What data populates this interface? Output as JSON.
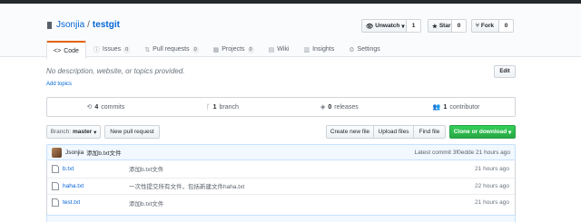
{
  "repo": {
    "owner": "Jsonjia",
    "separator": "/",
    "name": "testgit"
  },
  "actions": {
    "watch": {
      "label": "Unwatch",
      "count": "1"
    },
    "star": {
      "label": "Star",
      "count": "0"
    },
    "fork": {
      "label": "Fork",
      "count": "0"
    }
  },
  "tabs": [
    {
      "label": "Code",
      "counter": ""
    },
    {
      "label": "Issues",
      "counter": "0"
    },
    {
      "label": "Pull requests",
      "counter": "0"
    },
    {
      "label": "Projects",
      "counter": "0"
    },
    {
      "label": "Wiki",
      "counter": ""
    },
    {
      "label": "Insights",
      "counter": ""
    },
    {
      "label": "Settings",
      "counter": ""
    }
  ],
  "description": {
    "text": "No description, website, or topics provided.",
    "add_topics": "Add topics",
    "edit_label": "Edit"
  },
  "summary": {
    "commits_num": "4",
    "commits_label": "commits",
    "branch_num": "1",
    "branch_label": "branch",
    "releases_num": "0",
    "releases_label": "releases",
    "contributors_num": "1",
    "contributors_label": "contributor"
  },
  "toolbar": {
    "branch_label": "Branch:",
    "branch_value": "master",
    "new_pr": "New pull request",
    "create_file": "Create new file",
    "upload_files": "Upload files",
    "find_file": "Find file",
    "clone": "Clone or download"
  },
  "latest_commit": {
    "author": "Jsonjia",
    "message": "添加b.txt文件",
    "prefix": "Latest commit",
    "sha": "3f0edde",
    "age": "21 hours ago"
  },
  "files": [
    {
      "name": "b.txt",
      "message": "添加b.txt文件",
      "age": "21 hours ago"
    },
    {
      "name": "haha.txt",
      "message": "一次性提交所有文件，包括新建文件haha.txt",
      "age": "22 hours ago"
    },
    {
      "name": "test.txt",
      "message": "添加b.txt文件",
      "age": "21 hours ago"
    }
  ],
  "colors": {
    "accent": "#e36209",
    "link": "#0366d6",
    "primary_button": "#28a745"
  }
}
